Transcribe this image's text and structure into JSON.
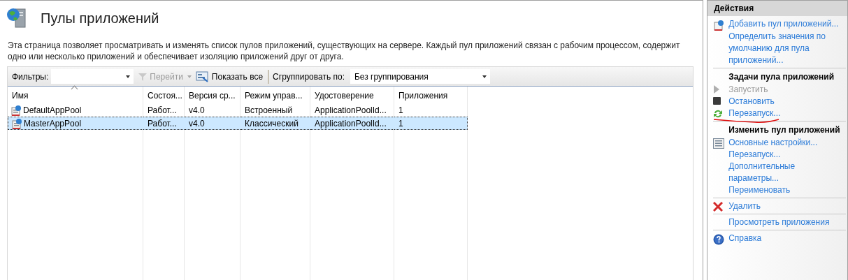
{
  "page": {
    "title": "Пулы приложений",
    "description": "Эта страница позволяет просматривать и изменять список пулов приложений, существующих на сервере. Каждый пул приложений связан с рабочим процессом, содержит одно или несколько приложений и обеспечивает изоляцию приложений друг от друга."
  },
  "toolbar": {
    "filter_label": "Фильтры:",
    "go_button": {
      "label": "Перейти",
      "disabled": true
    },
    "show_all": "Показать все",
    "group_label": "Сгруппировать по:",
    "group_value": "Без группирования"
  },
  "table": {
    "columns": [
      {
        "label": "Имя",
        "sorted": true
      },
      {
        "label": "Состоя...",
        "sorted": false
      },
      {
        "label": "Версия ср...",
        "sorted": false
      },
      {
        "label": "Режим управ...",
        "sorted": false
      },
      {
        "label": "Удостоверение",
        "sorted": false
      },
      {
        "label": "Приложения",
        "sorted": false
      }
    ],
    "rows": [
      {
        "cells": [
          "DefaultAppPool",
          "Работ...",
          "v4.0",
          "Встроенный",
          "ApplicationPoolId...",
          "1"
        ],
        "selected": false
      },
      {
        "cells": [
          "MasterAppPool",
          "Работ...",
          "v4.0",
          "Классический",
          "ApplicationPoolId...",
          "1"
        ],
        "selected": true
      }
    ]
  },
  "actions": {
    "title": "Действия",
    "groups": [
      {
        "items": [
          {
            "label": "Добавить пул приложений...",
            "disabled": false
          },
          {
            "label": "Определить значения по умолчанию для пула приложений...",
            "disabled": false
          }
        ]
      },
      {
        "heading": "Задачи пула приложений",
        "items": [
          {
            "label": "Запустить",
            "disabled": true
          },
          {
            "label": "Остановить",
            "disabled": false
          },
          {
            "label": "Перезапуск...",
            "disabled": false
          }
        ]
      },
      {
        "heading": "Изменить пул приложений",
        "items": [
          {
            "label": "Основные настройки...",
            "disabled": false
          },
          {
            "label": "Перезапуск...",
            "disabled": false
          },
          {
            "label": "Дополнительные параметры...",
            "disabled": false
          },
          {
            "label": "Переименовать",
            "disabled": false
          }
        ]
      },
      {
        "items": [
          {
            "label": "Удалить",
            "disabled": false
          }
        ]
      },
      {
        "items": [
          {
            "label": "Просмотреть приложения",
            "disabled": false
          }
        ]
      },
      {
        "items": [
          {
            "label": "Справка",
            "disabled": false
          }
        ]
      }
    ]
  }
}
